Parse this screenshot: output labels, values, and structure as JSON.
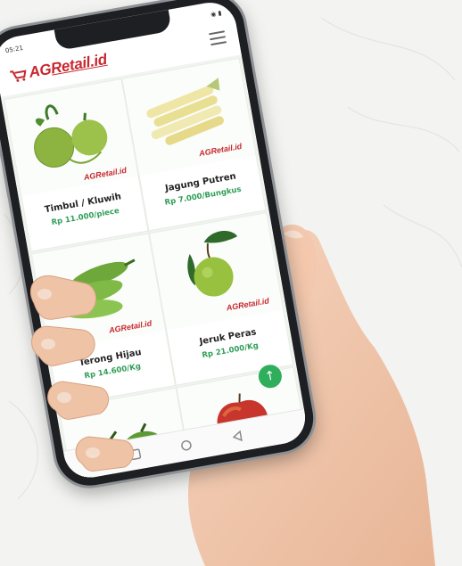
{
  "status_bar": {
    "time": "05:21",
    "icons": "◉ ▮"
  },
  "app": {
    "logo_prefix": "AG",
    "logo_highlight": "Retail.id",
    "brand_color": "#c7282e",
    "accent_color": "#2f9e58",
    "watermark": "AGRetail.id"
  },
  "products": [
    {
      "name": "Timbul / Kluwih",
      "price": "Rp 11.000/piece"
    },
    {
      "name": "Jagung Putren",
      "price": "Rp 7.000/Bungkus"
    },
    {
      "name": "Terong Hijau",
      "price": "Rp 14.600/Kg"
    },
    {
      "name": "Jeruk Peras",
      "price": "Rp 21.000/Kg"
    }
  ],
  "icons": {
    "menu": "hamburger-menu-icon",
    "scroll_top": "arrow-up-icon",
    "nav": [
      "square-icon",
      "circle-icon",
      "triangle-back-icon"
    ]
  },
  "scroll_top_glyph": "↑"
}
